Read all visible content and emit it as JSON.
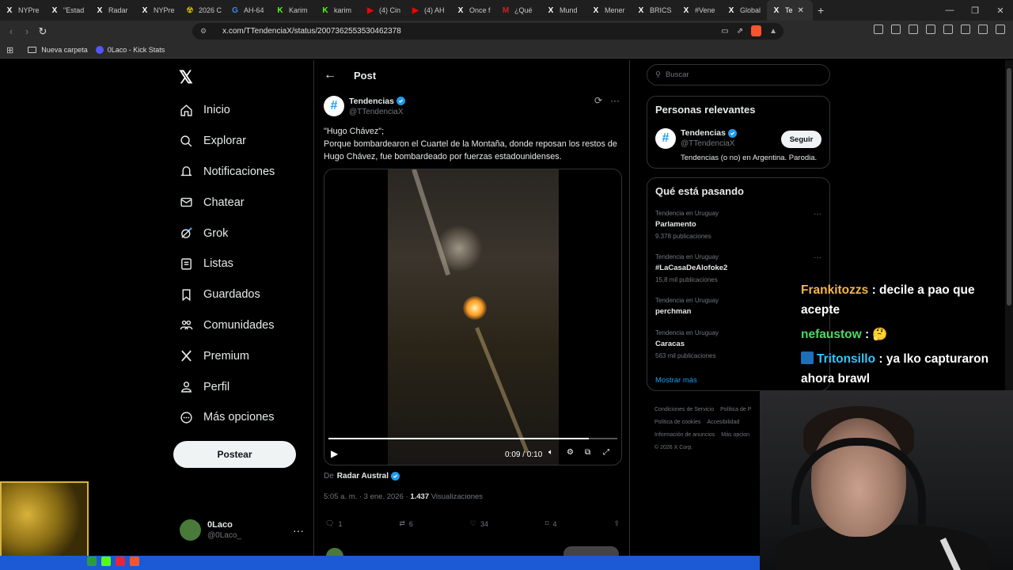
{
  "browser": {
    "tabs": [
      {
        "label": "NYPre",
        "fav": "X",
        "favcolor": "#000000"
      },
      {
        "label": "\"Estad",
        "fav": "X",
        "favcolor": "#000000"
      },
      {
        "label": "Radar",
        "fav": "X",
        "favcolor": "#000000"
      },
      {
        "label": "NYPre",
        "fav": "X",
        "favcolor": "#000000"
      },
      {
        "label": "2026 C",
        "fav": "☢",
        "favcolor": "#c8b400"
      },
      {
        "label": "AH-64",
        "fav": "G",
        "favcolor": "#4285f4"
      },
      {
        "label": "Karim",
        "fav": "K",
        "favcolor": "#53fc18"
      },
      {
        "label": "karim",
        "fav": "K",
        "favcolor": "#53fc18"
      },
      {
        "label": "(4) Cin",
        "fav": "▶",
        "favcolor": "#ff0000"
      },
      {
        "label": "(4) AH",
        "fav": "▶",
        "favcolor": "#ff0000"
      },
      {
        "label": "Once f",
        "fav": "X",
        "favcolor": "#000000"
      },
      {
        "label": "¿Qué",
        "fav": "M",
        "favcolor": "#cc2222"
      },
      {
        "label": "Mund",
        "fav": "X",
        "favcolor": "#000000"
      },
      {
        "label": "Mener",
        "fav": "X",
        "favcolor": "#000000"
      },
      {
        "label": "BRICS",
        "fav": "X",
        "favcolor": "#000000"
      },
      {
        "label": "#Vene",
        "fav": "X",
        "favcolor": "#000000"
      },
      {
        "label": "Global",
        "fav": "X",
        "favcolor": "#000000"
      },
      {
        "label": "Te",
        "fav": "X",
        "favcolor": "#000000",
        "active": true
      }
    ],
    "url": "x.com/TTendenciaX/status/2007362553530462378",
    "bookmarks": [
      {
        "label": "Nueva carpeta",
        "icon": "folder-icon"
      },
      {
        "label": "0Laco - Kick Stats",
        "icon": "kick-icon"
      }
    ]
  },
  "sidebar": {
    "logo": "𝕏",
    "items": [
      {
        "label": "Inicio",
        "icon": "home-icon"
      },
      {
        "label": "Explorar",
        "icon": "search-icon"
      },
      {
        "label": "Notificaciones",
        "icon": "bell-icon"
      },
      {
        "label": "Chatear",
        "icon": "mail-icon"
      },
      {
        "label": "Grok",
        "icon": "grok-icon"
      },
      {
        "label": "Listas",
        "icon": "list-icon"
      },
      {
        "label": "Guardados",
        "icon": "bookmark-icon"
      },
      {
        "label": "Comunidades",
        "icon": "people-icon"
      },
      {
        "label": "Premium",
        "icon": "x-icon"
      },
      {
        "label": "Perfil",
        "icon": "person-icon"
      },
      {
        "label": "Más opciones",
        "icon": "more-circle-icon"
      }
    ],
    "post_button": "Postear",
    "user": {
      "name": "0Laco",
      "handle": "@0Laco_"
    }
  },
  "main": {
    "header": "Post",
    "author": {
      "name": "Tendencias",
      "handle": "@TTendenciaX",
      "avatar": "#"
    },
    "text": {
      "line1": "\"Hugo Chávez\";",
      "line2": "Porque bombardearon el Cuartel de la Montaña, donde reposan los restos de Hugo Chávez, fue bombardeado por fuerzas estadounidenses."
    },
    "video": {
      "time": "0:09 / 0:10",
      "progress": 0.9
    },
    "from_prefix": "De",
    "from_name": "Radar Austral",
    "meta": {
      "datetime": "5:05 a. m. · 3 ene. 2026 ·",
      "views": "1.437",
      "views_label": "Visualizaciones"
    },
    "actions": {
      "replies": "1",
      "reposts": "6",
      "likes": "34",
      "bookmarks": "4"
    }
  },
  "right": {
    "search_placeholder": "Buscar",
    "relevant": {
      "title": "Personas relevantes",
      "name": "Tendencias",
      "handle": "@TTendenciaX",
      "follow": "Seguir",
      "desc": "Tendencias (o no) en Argentina. Parodia."
    },
    "trending": {
      "title": "Qué está pasando",
      "items": [
        {
          "ctx": "Tendencia en Uruguay",
          "name": "Parlamento",
          "count": "9.378 publicaciones"
        },
        {
          "ctx": "Tendencia en Uruguay",
          "name": "#LaCasaDeAlofoke2",
          "count": "15,8 mil publicaciones"
        },
        {
          "ctx": "Tendencia en Uruguay",
          "name": "perchman",
          "count": ""
        },
        {
          "ctx": "Tendencia en Uruguay",
          "name": "Caracas",
          "count": "563 mil publicaciones"
        }
      ],
      "more": "Mostrar más"
    },
    "footer": {
      "l1a": "Condiciones de Servicio",
      "l1b": "Política de P",
      "l2a": "Política de cookies",
      "l2b": "Accesibilidad",
      "l3a": "Información de anuncios",
      "l3b": "Más opcion",
      "l4": "© 2026 X Corp."
    }
  },
  "stream_chat": [
    {
      "user": "Frankitozzs",
      "msg": ": decile a pao que acepte"
    },
    {
      "user": "nefaustow",
      "msg": ": 🤔"
    },
    {
      "user": "Tritonsillo",
      "msg": ": ya lko capturaron ahora brawl"
    }
  ]
}
